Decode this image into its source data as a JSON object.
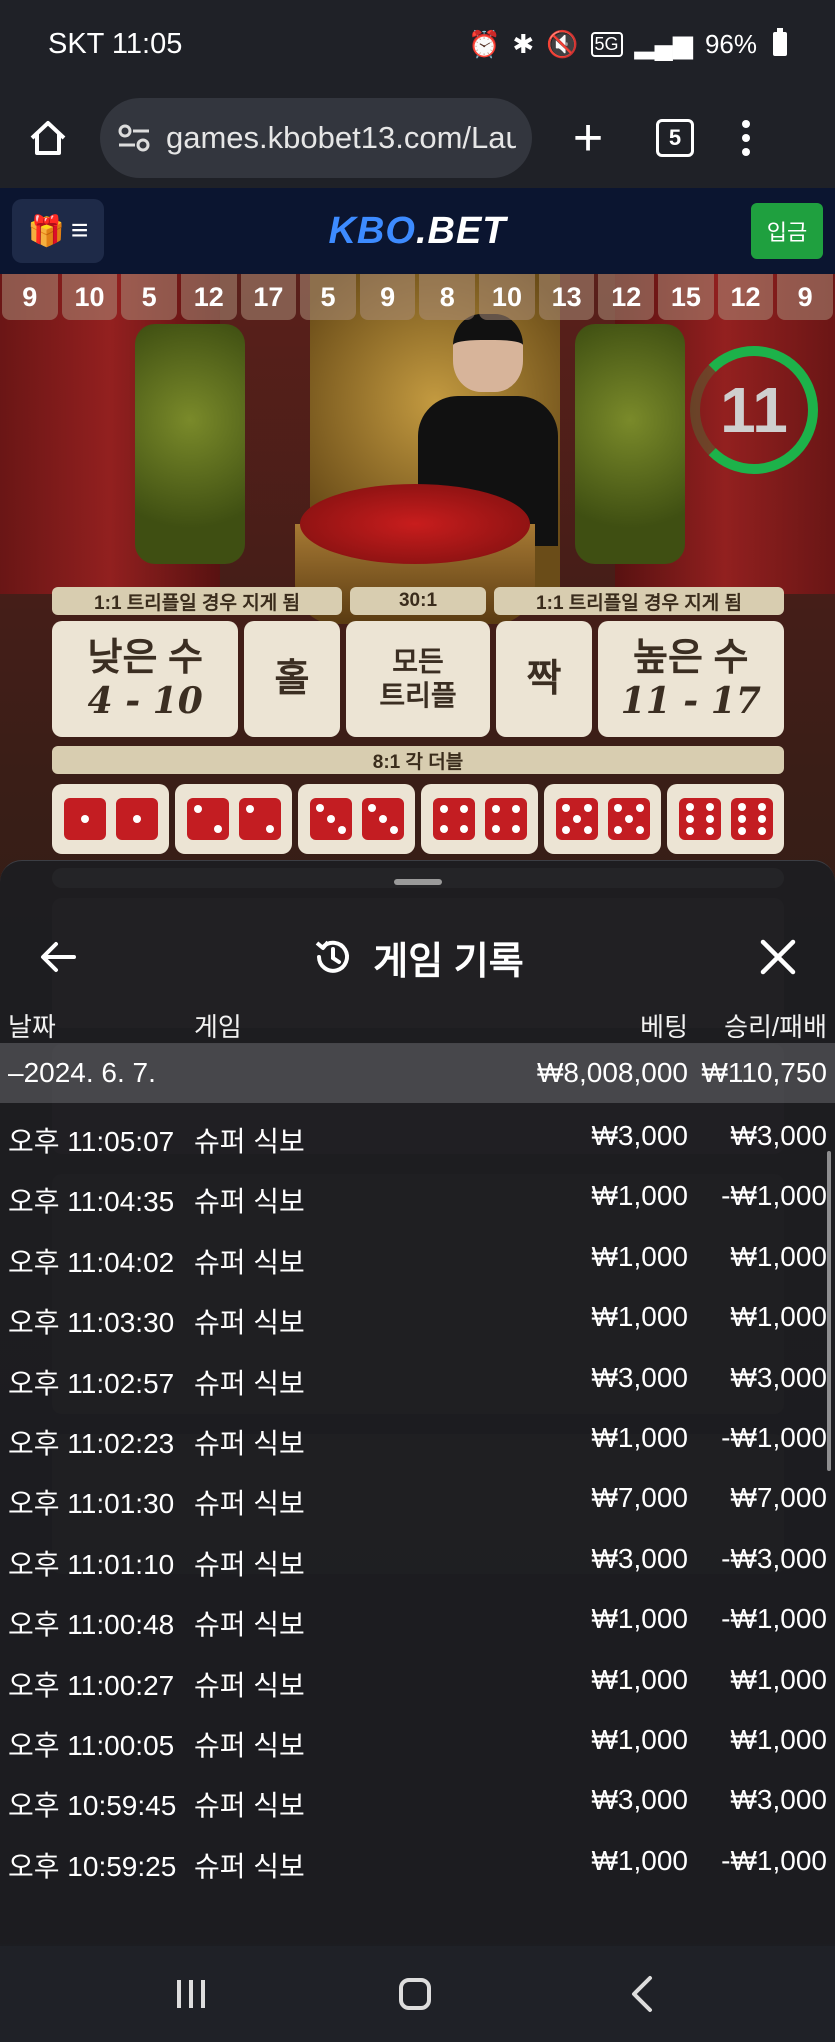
{
  "status": {
    "carrier_time": "SKT 11:05",
    "battery": "96%",
    "network": "5G"
  },
  "browser": {
    "url": "games.kbobet13.com/Lau",
    "tab_count": "5"
  },
  "site": {
    "logo_part1": "KBO",
    "logo_part2": ".BET",
    "deposit_label": "입금"
  },
  "game": {
    "history_numbers": [
      "9",
      "10",
      "5",
      "12",
      "17",
      "5",
      "9",
      "8",
      "10",
      "13",
      "12",
      "15",
      "12",
      "9"
    ],
    "timer": "11",
    "labels": {
      "left": "1:1 트리플일 경우 지게 됨",
      "mid": "30:1",
      "right": "1:1 트리플일 경우 지게 됨",
      "double": "8:1 각 더블"
    },
    "bets": {
      "low_main": "낮은 수",
      "low_sub": "4 - 10",
      "odd": "홀",
      "triple_line1": "모든",
      "triple_line2": "트리플",
      "even": "짝",
      "high_main": "높은 수",
      "high_sub": "11 - 17"
    }
  },
  "panel": {
    "title": "게임 기록",
    "columns": {
      "date": "날짜",
      "game": "게임",
      "bet": "베팅",
      "result": "승리/패배"
    },
    "summary": {
      "date": "–2024. 6. 7.",
      "bet": "₩8,008,000",
      "result": "₩110,750"
    },
    "rows": [
      {
        "time": "오후 11:05:07",
        "game": "슈퍼 식보",
        "bet": "₩3,000",
        "result": "₩3,000"
      },
      {
        "time": "오후 11:04:35",
        "game": "슈퍼 식보",
        "bet": "₩1,000",
        "result": "-₩1,000"
      },
      {
        "time": "오후 11:04:02",
        "game": "슈퍼 식보",
        "bet": "₩1,000",
        "result": "₩1,000"
      },
      {
        "time": "오후 11:03:30",
        "game": "슈퍼 식보",
        "bet": "₩1,000",
        "result": "₩1,000"
      },
      {
        "time": "오후 11:02:57",
        "game": "슈퍼 식보",
        "bet": "₩3,000",
        "result": "₩3,000"
      },
      {
        "time": "오후 11:02:23",
        "game": "슈퍼 식보",
        "bet": "₩1,000",
        "result": "-₩1,000"
      },
      {
        "time": "오후 11:01:30",
        "game": "슈퍼 식보",
        "bet": "₩7,000",
        "result": "₩7,000"
      },
      {
        "time": "오후 11:01:10",
        "game": "슈퍼 식보",
        "bet": "₩3,000",
        "result": "-₩3,000"
      },
      {
        "time": "오후 11:00:48",
        "game": "슈퍼 식보",
        "bet": "₩1,000",
        "result": "-₩1,000"
      },
      {
        "time": "오후 11:00:27",
        "game": "슈퍼 식보",
        "bet": "₩1,000",
        "result": "₩1,000"
      },
      {
        "time": "오후 11:00:05",
        "game": "슈퍼 식보",
        "bet": "₩1,000",
        "result": "₩1,000"
      },
      {
        "time": "오후 10:59:45",
        "game": "슈퍼 식보",
        "bet": "₩3,000",
        "result": "₩3,000"
      },
      {
        "time": "오후 10:59:25",
        "game": "슈퍼 식보",
        "bet": "₩1,000",
        "result": "-₩1,000"
      }
    ]
  },
  "colors": {
    "accent_green": "#1fa03f",
    "timer_green": "#1db24a",
    "logo_blue": "#3d8bff",
    "die_red": "#c31d22"
  }
}
